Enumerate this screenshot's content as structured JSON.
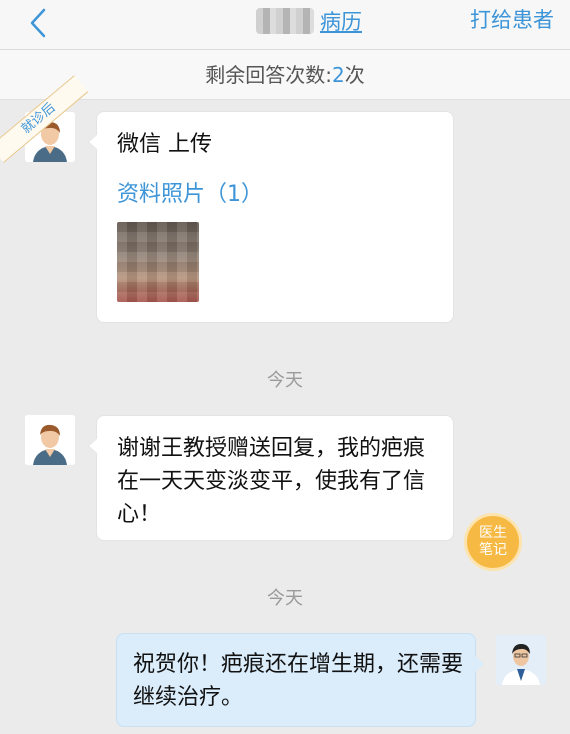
{
  "header": {
    "back_icon": "chevron-left-icon",
    "record_link": "病历",
    "call_patient": "打给患者"
  },
  "remaining": {
    "prefix": "剩余回答次数:",
    "count": "2",
    "suffix": "次"
  },
  "ribbon": {
    "label": "就诊后"
  },
  "messages": [
    {
      "side": "left",
      "title": "微信 上传",
      "photo_label": "资料照片（1）"
    },
    {
      "side": "left",
      "text": "谢谢王教授赠送回复，我的疤痕在一天天变淡变平，使我有了信心！"
    },
    {
      "side": "right",
      "text": "祝贺你！疤痕还在增生期，还需要继续治疗。"
    }
  ],
  "time_labels": [
    "今天",
    "今天"
  ],
  "doctor_notes": {
    "line1": "医生",
    "line2": "笔记"
  },
  "colors": {
    "accent": "#3d95d8",
    "notes": "#f6b943",
    "reply_bubble": "#dbedfb"
  }
}
